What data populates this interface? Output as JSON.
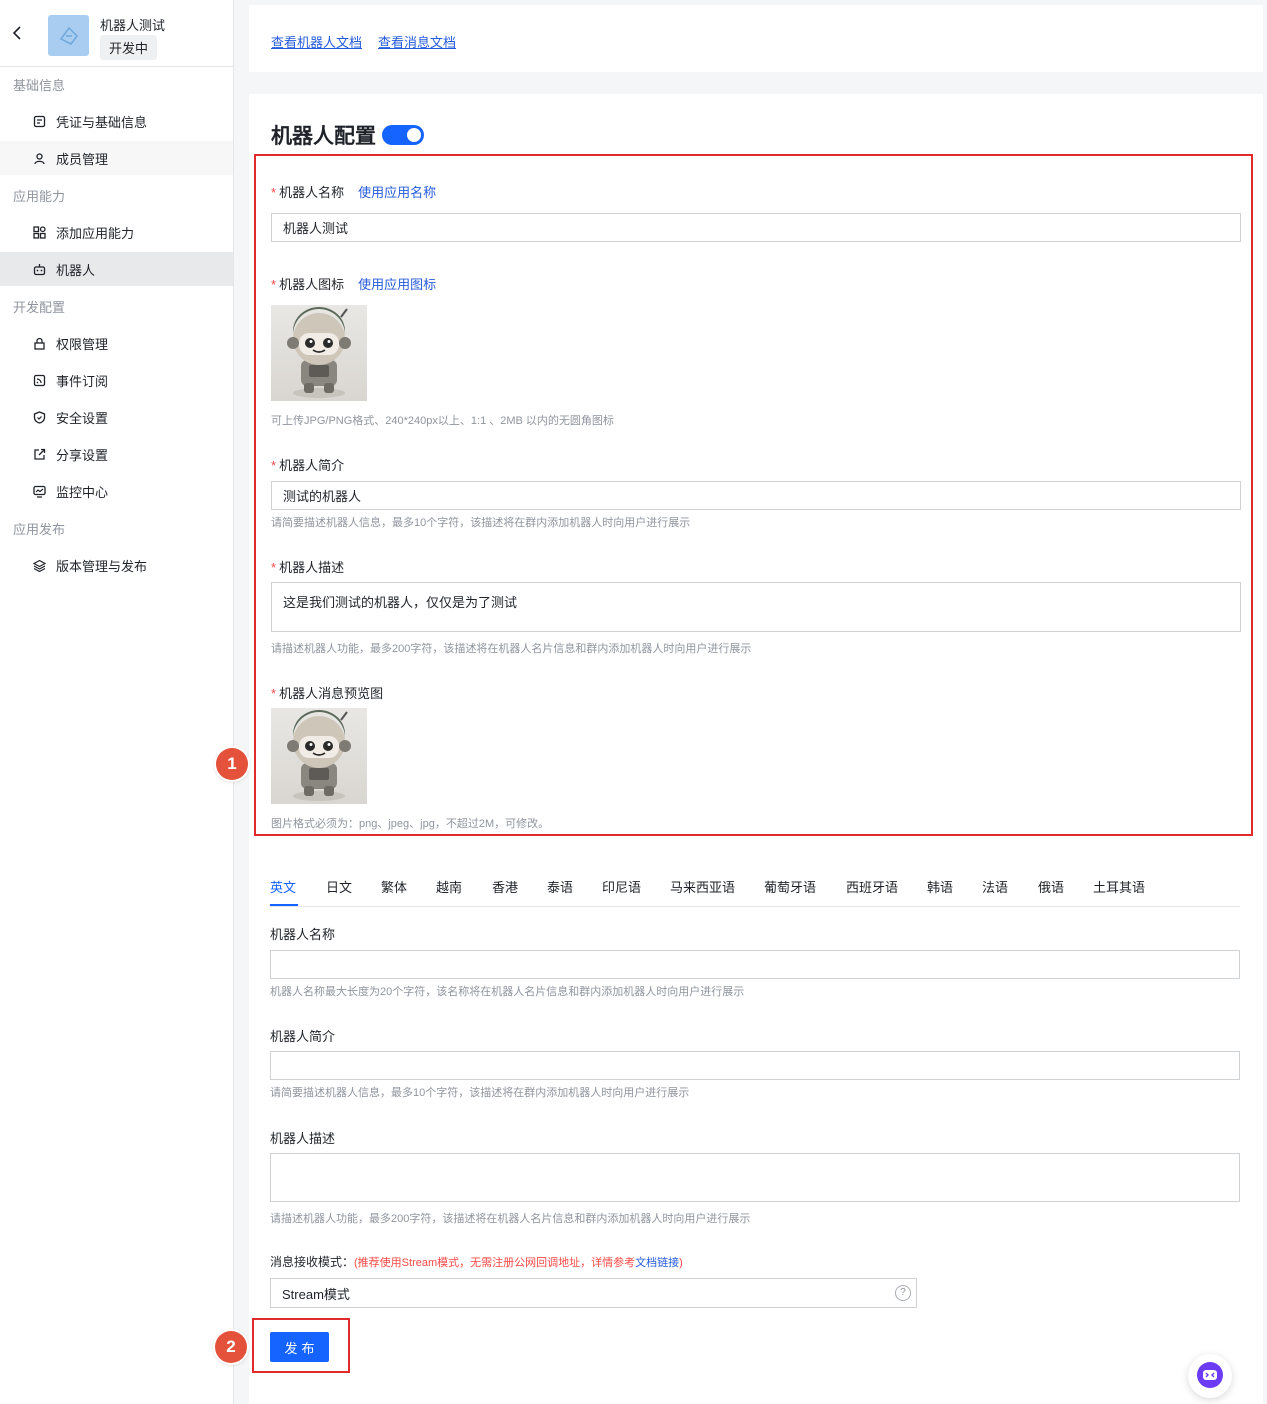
{
  "sidebar": {
    "app_name": "机器人测试",
    "app_status": "开发中",
    "groups": [
      {
        "title": "基础信息",
        "items": [
          {
            "label": "凭证与基础信息",
            "icon": "credential-icon"
          },
          {
            "label": "成员管理",
            "icon": "member-icon"
          }
        ]
      },
      {
        "title": "应用能力",
        "items": [
          {
            "label": "添加应用能力",
            "icon": "apps-icon"
          },
          {
            "label": "机器人",
            "icon": "robot-icon"
          }
        ]
      },
      {
        "title": "开发配置",
        "items": [
          {
            "label": "权限管理",
            "icon": "lock-icon"
          },
          {
            "label": "事件订阅",
            "icon": "rss-icon"
          },
          {
            "label": "安全设置",
            "icon": "shield-icon"
          },
          {
            "label": "分享设置",
            "icon": "share-icon"
          },
          {
            "label": "监控中心",
            "icon": "monitor-icon"
          }
        ]
      },
      {
        "title": "应用发布",
        "items": [
          {
            "label": "版本管理与发布",
            "icon": "layers-icon"
          }
        ]
      }
    ]
  },
  "top_links": {
    "bot_docs": "查看机器人文档",
    "msg_docs": "查看消息文档"
  },
  "config": {
    "title": "机器人配置",
    "name": {
      "label": "机器人名称",
      "link": "使用应用名称",
      "value": "机器人测试"
    },
    "icon": {
      "label": "机器人图标",
      "link": "使用应用图标",
      "help": "可上传JPG/PNG格式、240*240px以上、1:1 、2MB 以内的无圆角图标"
    },
    "intro": {
      "label": "机器人简介",
      "value": "测试的机器人",
      "help": "请简要描述机器人信息，最多10个字符，该描述将在群内添加机器人时向用户进行展示"
    },
    "desc": {
      "label": "机器人描述",
      "value": "这是我们测试的机器人，仅仅是为了测试",
      "help": "请描述机器人功能，最多200字符，该描述将在机器人名片信息和群内添加机器人时向用户进行展示"
    },
    "preview": {
      "label": "机器人消息预览图",
      "help": "图片格式必须为：png、jpeg、jpg，不超过2M，可修改。"
    }
  },
  "lang_tabs": [
    "英文",
    "日文",
    "繁体",
    "越南",
    "香港",
    "泰语",
    "印尼语",
    "马来西亚语",
    "葡萄牙语",
    "西班牙语",
    "韩语",
    "法语",
    "俄语",
    "土耳其语"
  ],
  "i18n": {
    "name": {
      "label": "机器人名称",
      "help": "机器人名称最大长度为20个字符，该名称将在机器人名片信息和群内添加机器人时向用户进行展示"
    },
    "intro": {
      "label": "机器人简介",
      "help": "请简要描述机器人信息，最多10个字符，该描述将在群内添加机器人时向用户进行展示"
    },
    "desc": {
      "label": "机器人描述",
      "help": "请描述机器人功能，最多200字符，该描述将在机器人名片信息和群内添加机器人时向用户进行展示"
    }
  },
  "receive_mode": {
    "label": "消息接收模式：",
    "note_prefix": "(推荐使用Stream模式，无需注册公网回调地址，详情参考",
    "note_link": "文档链接",
    "note_suffix": ")",
    "value": "Stream模式",
    "help_icon": "?"
  },
  "publish_label": "发布",
  "annotations": {
    "badge1": "1",
    "badge2": "2"
  },
  "colors": {
    "primary": "#1664ff",
    "annotation_red": "#e02b2b",
    "required": "#f54a45"
  }
}
